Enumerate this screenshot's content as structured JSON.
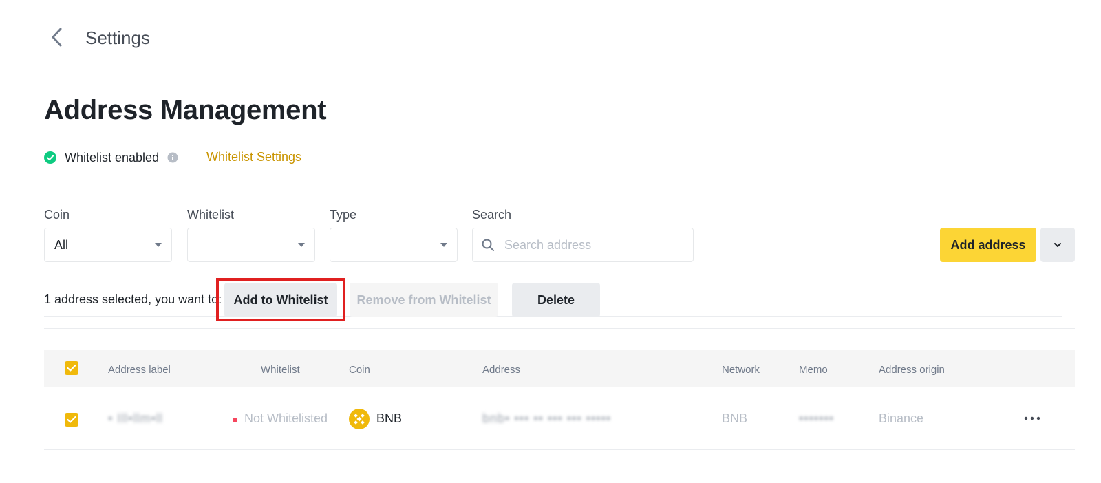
{
  "header": {
    "title": "Settings"
  },
  "page": {
    "title": "Address Management"
  },
  "whitelist_status": {
    "text": "Whitelist enabled",
    "settings_link": "Whitelist Settings"
  },
  "filters": {
    "coin": {
      "label": "Coin",
      "value": "All"
    },
    "whitelist": {
      "label": "Whitelist",
      "value": ""
    },
    "type": {
      "label": "Type",
      "value": ""
    },
    "search": {
      "label": "Search",
      "placeholder": "Search address"
    }
  },
  "actions": {
    "add_address": "Add address"
  },
  "bulk": {
    "selected_text": "1 address selected, you want to:",
    "add_to_whitelist": "Add to Whitelist",
    "remove_from_whitelist": "Remove from Whitelist",
    "delete": "Delete"
  },
  "table": {
    "columns": [
      "Address label",
      "Whitelist",
      "Coin",
      "Address",
      "Network",
      "Memo",
      "Address origin"
    ],
    "rows": [
      {
        "label": "• Ill•llm•ll",
        "whitelist": "Not Whitelisted",
        "coin": "BNB",
        "address": "bnb• ••• •• ••• ••• •••••",
        "network": "BNB",
        "memo": "•••••••",
        "origin": "Binance"
      }
    ]
  },
  "colors": {
    "accent": "#fcd535",
    "checkbox": "#f0b90b",
    "link": "#c99400",
    "success": "#0ecb81",
    "danger": "#f6465d",
    "highlight": "#e02020"
  },
  "icons": [
    "back-arrow-icon",
    "check-circle-icon",
    "info-icon",
    "search-icon",
    "chevron-down-icon",
    "checkbox-checked-icon",
    "bnb-coin-icon",
    "more-horizontal-icon"
  ]
}
